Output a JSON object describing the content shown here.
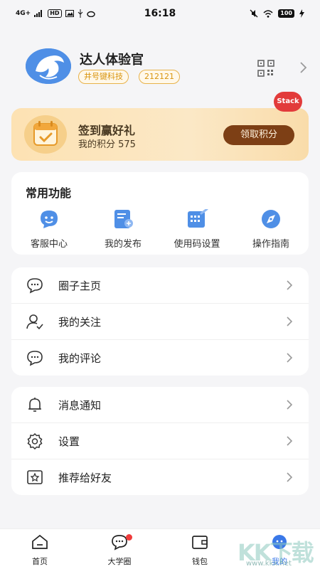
{
  "status_bar": {
    "network": "4G+",
    "hd_label": "HD",
    "time": "16:18",
    "battery": "100"
  },
  "profile": {
    "name": "达人体验官",
    "tag_company": "井号键科技",
    "tag_id": "212121"
  },
  "debug_badge": "Stack",
  "checkin": {
    "title": "签到赢好礼",
    "points_text": "我的积分 575",
    "button_label": "领取积分"
  },
  "functions": {
    "title": "常用功能",
    "items": [
      {
        "label": "客服中心",
        "icon": "customer-service-icon"
      },
      {
        "label": "我的发布",
        "icon": "my-posts-icon"
      },
      {
        "label": "使用码设置",
        "icon": "code-settings-icon"
      },
      {
        "label": "操作指南",
        "icon": "guide-compass-icon"
      }
    ]
  },
  "list_group_1": [
    {
      "label": "圈子主页",
      "icon": "chat-bubble-icon"
    },
    {
      "label": "我的关注",
      "icon": "user-follow-icon"
    },
    {
      "label": "我的评论",
      "icon": "comment-icon"
    }
  ],
  "list_group_2": [
    {
      "label": "消息通知",
      "icon": "bell-icon"
    },
    {
      "label": "设置",
      "icon": "gear-icon"
    },
    {
      "label": "推荐给好友",
      "icon": "star-box-icon"
    }
  ],
  "tabs": [
    {
      "label": "首页",
      "icon": "home-icon"
    },
    {
      "label": "大学圈",
      "icon": "circle-chat-icon"
    },
    {
      "label": "钱包",
      "icon": "wallet-icon"
    },
    {
      "label": "我的",
      "icon": "profile-icon"
    }
  ],
  "watermark": {
    "logo_text": "KK下载",
    "url": "www.kkx.net"
  },
  "colors": {
    "accent": "#3a78e8",
    "checkin_button": "#7d3f15",
    "tag_border": "#e8b24a",
    "badge_red": "#e23b3b"
  }
}
